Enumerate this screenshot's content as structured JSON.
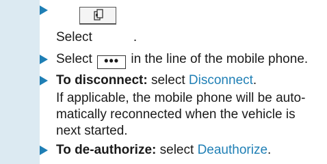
{
  "steps": [
    {
      "select_label": "Select",
      "period": "."
    },
    {
      "select_label": "Select",
      "button_label": "•••",
      "rest": "in the line of the mobile phone."
    },
    {
      "lead": "To disconnect:",
      "select_label": "select",
      "action": "Disconnect",
      "period": ".",
      "note_lines": [
        "If applicable, the mobile phone will be auto-",
        "matically reconnected when the vehicle is",
        "next started."
      ]
    },
    {
      "lead": "To de-authorize:",
      "select_label": "select",
      "action": "Deauthorize",
      "period": "."
    }
  ],
  "icons": {
    "phone_icon": "phone-switch-icon"
  },
  "colors": {
    "accent": "#1f7fb5",
    "strip": "#dceaf2"
  }
}
